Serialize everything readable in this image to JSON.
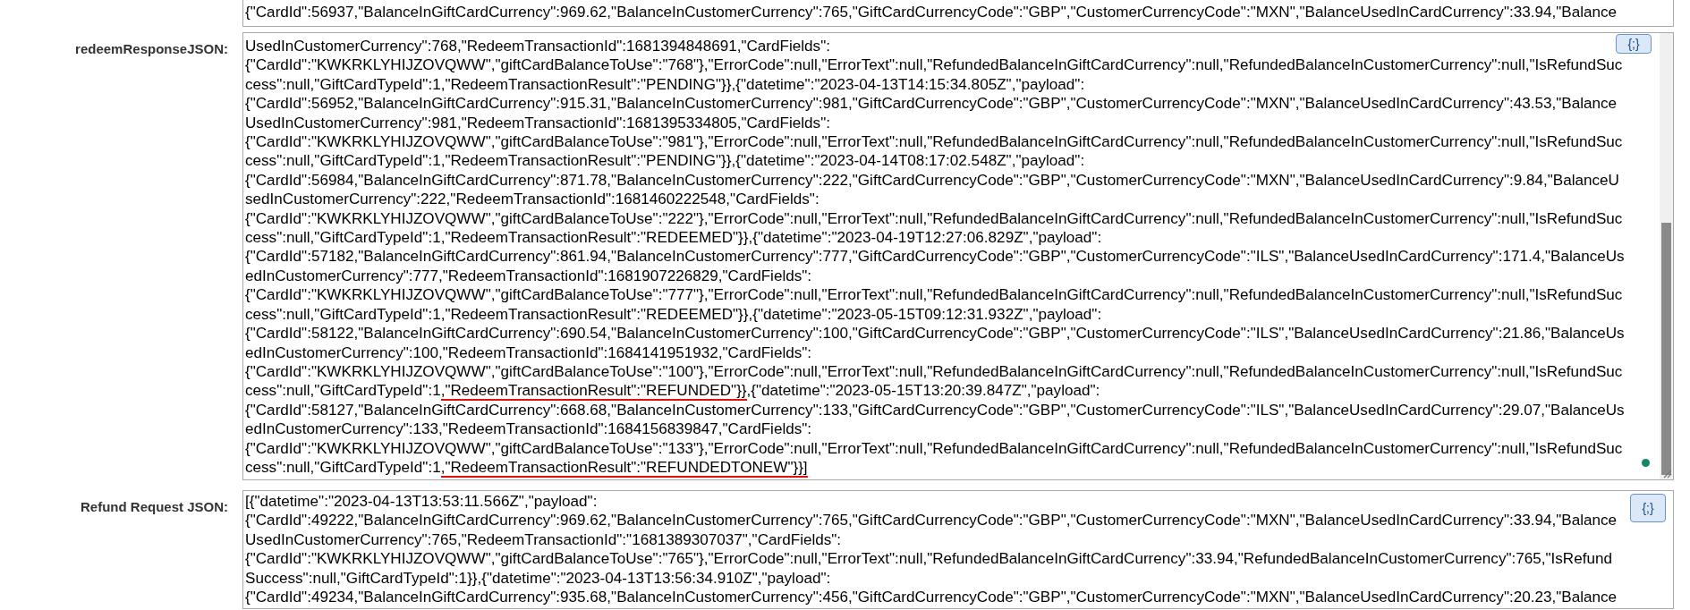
{
  "fields": [
    {
      "has_scrollbar": false,
      "status_dot": false,
      "lines": [
        "{\"CardId\":56937,\"BalanceInGiftCardCurrency\":969.62,\"BalanceInCustomerCurrency\":765,\"GiftCardCurrencyCode\":\"GBP\",\"CustomerCurrencyCode\":\"MXN\",\"BalanceUsedInCardCurrency\":33.94,\"Balance"
      ]
    },
    {
      "label": "redeemResponseJSON:",
      "format_button": "{;}",
      "has_scrollbar": true,
      "status_dot": true,
      "lines": [
        "UsedInCustomerCurrency\":768,\"RedeemTransactionId\":1681394848691,\"CardFields\":",
        "{\"CardId\":\"KWKRKLYHIJZOVQWW\",\"giftCardBalanceToUse\":\"768\"},\"ErrorCode\":null,\"ErrorText\":null,\"RefundedBalanceInGiftCardCurrency\":null,\"RefundedBalanceInCustomerCurrency\":null,\"IsRefundSuc",
        "cess\":null,\"GiftCardTypeId\":1,\"RedeemTransactionResult\":\"PENDING\"}},{\"datetime\":\"2023-04-13T14:15:34.805Z\",\"payload\":",
        "{\"CardId\":56952,\"BalanceInGiftCardCurrency\":915.31,\"BalanceInCustomerCurrency\":981,\"GiftCardCurrencyCode\":\"GBP\",\"CustomerCurrencyCode\":\"MXN\",\"BalanceUsedInCardCurrency\":43.53,\"Balance",
        "UsedInCustomerCurrency\":981,\"RedeemTransactionId\":1681395334805,\"CardFields\":",
        "{\"CardId\":\"KWKRKLYHIJZOVQWW\",\"giftCardBalanceToUse\":\"981\"},\"ErrorCode\":null,\"ErrorText\":null,\"RefundedBalanceInGiftCardCurrency\":null,\"RefundedBalanceInCustomerCurrency\":null,\"IsRefundSuc",
        "cess\":null,\"GiftCardTypeId\":1,\"RedeemTransactionResult\":\"PENDING\"}},{\"datetime\":\"2023-04-14T08:17:02.548Z\",\"payload\":",
        "{\"CardId\":56984,\"BalanceInGiftCardCurrency\":871.78,\"BalanceInCustomerCurrency\":222,\"GiftCardCurrencyCode\":\"GBP\",\"CustomerCurrencyCode\":\"MXN\",\"BalanceUsedInCardCurrency\":9.84,\"BalanceU",
        "sedInCustomerCurrency\":222,\"RedeemTransactionId\":1681460222548,\"CardFields\":",
        "{\"CardId\":\"KWKRKLYHIJZOVQWW\",\"giftCardBalanceToUse\":\"222\"},\"ErrorCode\":null,\"ErrorText\":null,\"RefundedBalanceInGiftCardCurrency\":null,\"RefundedBalanceInCustomerCurrency\":null,\"IsRefundSuc",
        "cess\":null,\"GiftCardTypeId\":1,\"RedeemTransactionResult\":\"REDEEMED\"}},{\"datetime\":\"2023-04-19T12:27:06.829Z\",\"payload\":",
        "{\"CardId\":57182,\"BalanceInGiftCardCurrency\":861.94,\"BalanceInCustomerCurrency\":777,\"GiftCardCurrencyCode\":\"GBP\",\"CustomerCurrencyCode\":\"ILS\",\"BalanceUsedInCardCurrency\":171.4,\"BalanceUs",
        "edInCustomerCurrency\":777,\"RedeemTransactionId\":1681907226829,\"CardFields\":",
        "{\"CardId\":\"KWKRKLYHIJZOVQWW\",\"giftCardBalanceToUse\":\"777\"},\"ErrorCode\":null,\"ErrorText\":null,\"RefundedBalanceInGiftCardCurrency\":null,\"RefundedBalanceInCustomerCurrency\":null,\"IsRefundSuc",
        "cess\":null,\"GiftCardTypeId\":1,\"RedeemTransactionResult\":\"REDEEMED\"}},{\"datetime\":\"2023-05-15T09:12:31.932Z\",\"payload\":",
        "{\"CardId\":58122,\"BalanceInGiftCardCurrency\":690.54,\"BalanceInCustomerCurrency\":100,\"GiftCardCurrencyCode\":\"GBP\",\"CustomerCurrencyCode\":\"ILS\",\"BalanceUsedInCardCurrency\":21.86,\"BalanceUs",
        "edInCustomerCurrency\":100,\"RedeemTransactionId\":1684141951932,\"CardFields\":",
        "{\"CardId\":\"KWKRKLYHIJZOVQWW\",\"giftCardBalanceToUse\":\"100\"},\"ErrorCode\":null,\"ErrorText\":null,\"RefundedBalanceInGiftCardCurrency\":null,\"RefundedBalanceInCustomerCurrency\":null,\"IsRefundSuc",
        {
          "parts": [
            {
              "text": "cess\":null,\"GiftCardTypeId\":1",
              "underlined": false
            },
            {
              "text": ",\"RedeemTransactionResult\":\"REFUNDED\"}}",
              "underlined": true
            },
            {
              "text": ",{\"datetime\":\"2023-05-15T13:20:39.847Z\",\"payload\":",
              "underlined": false
            }
          ]
        },
        "{\"CardId\":58127,\"BalanceInGiftCardCurrency\":668.68,\"BalanceInCustomerCurrency\":133,\"GiftCardCurrencyCode\":\"GBP\",\"CustomerCurrencyCode\":\"ILS\",\"BalanceUsedInCardCurrency\":29.07,\"BalanceUs",
        "edInCustomerCurrency\":133,\"RedeemTransactionId\":1684156839847,\"CardFields\":",
        "{\"CardId\":\"KWKRKLYHIJZOVQWW\",\"giftCardBalanceToUse\":\"133\"},\"ErrorCode\":null,\"ErrorText\":null,\"RefundedBalanceInGiftCardCurrency\":null,\"RefundedBalanceInCustomerCurrency\":null,\"IsRefundSuc",
        {
          "parts": [
            {
              "text": "cess\":null,\"GiftCardTypeId\":1",
              "underlined": false
            },
            {
              "text": ",\"RedeemTransactionResult\":\"REFUNDEDTONEW\"}}]",
              "underlined": true
            }
          ]
        }
      ]
    },
    {
      "label": "Refund Request JSON:",
      "format_button": "{;}",
      "has_scrollbar": false,
      "status_dot": false,
      "lines": [
        "[{\"datetime\":\"2023-04-13T13:53:11.566Z\",\"payload\":",
        "{\"CardId\":49222,\"BalanceInGiftCardCurrency\":969.62,\"BalanceInCustomerCurrency\":765,\"GiftCardCurrencyCode\":\"GBP\",\"CustomerCurrencyCode\":\"MXN\",\"BalanceUsedInCardCurrency\":33.94,\"Balance",
        "UsedInCustomerCurrency\":765,\"RedeemTransactionId\":\"1681389307037\",\"CardFields\":",
        "{\"CardId\":\"KWKRKLYHIJZOVQWW\",\"giftCardBalanceToUse\":\"765\"},\"ErrorCode\":null,\"ErrorText\":null,\"RefundedBalanceInGiftCardCurrency\":33.94,\"RefundedBalanceInCustomerCurrency\":765,\"IsRefund",
        "Success\":null,\"GiftCardTypeId\":1}},{\"datetime\":\"2023-04-13T13:56:34.910Z\",\"payload\":",
        "{\"CardId\":49234,\"BalanceInGiftCardCurrency\":935.68,\"BalanceInCustomerCurrency\":456,\"GiftCardCurrencyCode\":\"GBP\",\"CustomerCurrencyCode\":\"MXN\",\"BalanceUsedInCardCurrency\":20.23,\"Balance"
      ]
    }
  ]
}
